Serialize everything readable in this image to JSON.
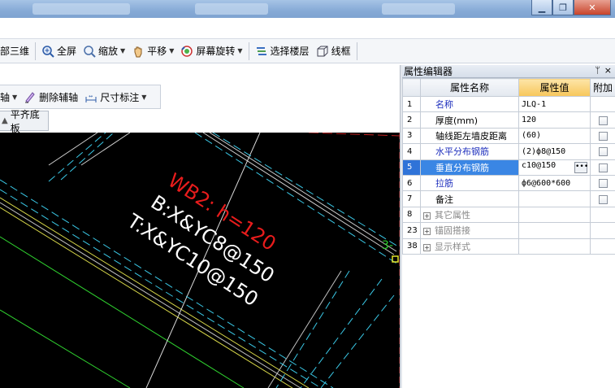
{
  "window": {
    "min_glyph": "▁",
    "max_glyph": "❐",
    "close_glyph": "✕"
  },
  "toolbar1": {
    "items": [
      {
        "label": "局部三维"
      },
      {
        "label": "全屏",
        "icon": "zoom-fit-icon"
      },
      {
        "label": "缩放",
        "icon": "zoom-icon"
      },
      {
        "label": "平移",
        "icon": "pan-hand-icon"
      },
      {
        "label": "屏幕旋转",
        "icon": "rotate-screen-icon"
      },
      {
        "label": "选择楼层",
        "icon": "select-floor-icon"
      },
      {
        "label": "线框",
        "icon": "wireframe-icon"
      }
    ]
  },
  "toolbar2": {
    "items": [
      {
        "label": "辅轴"
      },
      {
        "label": "删除辅轴",
        "icon": "delete-axis-icon"
      },
      {
        "label": "尺寸标注",
        "icon": "dimension-icon"
      }
    ]
  },
  "align_tab": {
    "label": "平齐底板",
    "icon": "align-icon"
  },
  "canvas": {
    "labels": {
      "wall_name": "WB2: h=120",
      "bottom_rebar": "B:X&YC8@150",
      "top_rebar": "T:X&YC10@150",
      "edge_marker": "3-"
    }
  },
  "property_editor": {
    "title": "属性编辑器",
    "pin_glyph": "ᛘ",
    "close_glyph": "×",
    "columns": {
      "name": "属性名称",
      "value": "属性值",
      "extra": "附加"
    },
    "rows": [
      {
        "num": "1",
        "name": "名称",
        "value": "JLQ-1",
        "style": "blue",
        "checkbox": false
      },
      {
        "num": "2",
        "name": "厚度(mm)",
        "value": "120",
        "style": "normal",
        "checkbox": true
      },
      {
        "num": "3",
        "name": "轴线距左墙皮距离",
        "value": "(60)",
        "style": "normal",
        "checkbox": true
      },
      {
        "num": "4",
        "name": "水平分布钢筋",
        "value": "(2)ф8@150",
        "style": "blue",
        "checkbox": true
      },
      {
        "num": "5",
        "name": "垂直分布钢筋",
        "value": "c10@150",
        "style": "selected",
        "checkbox": true
      },
      {
        "num": "6",
        "name": "拉筋",
        "value": "ф6@600*600",
        "style": "blue",
        "checkbox": true
      },
      {
        "num": "7",
        "name": "备注",
        "value": "",
        "style": "normal",
        "checkbox": true
      },
      {
        "num": "8",
        "name": "其它属性",
        "value": "",
        "style": "group",
        "checkbox": false
      },
      {
        "num": "23",
        "name": "锚固搭接",
        "value": "",
        "style": "group",
        "checkbox": false
      },
      {
        "num": "38",
        "name": "显示样式",
        "value": "",
        "style": "group",
        "checkbox": false
      }
    ]
  },
  "colors": {
    "canvas_bg": "#000000",
    "label_red": "#e81c1c",
    "label_white": "#ffffff",
    "line_cyan": "#3ac8e6",
    "line_yellow": "#d8d84a",
    "line_green": "#2fd12f",
    "selection_blue": "#3a86e4"
  }
}
